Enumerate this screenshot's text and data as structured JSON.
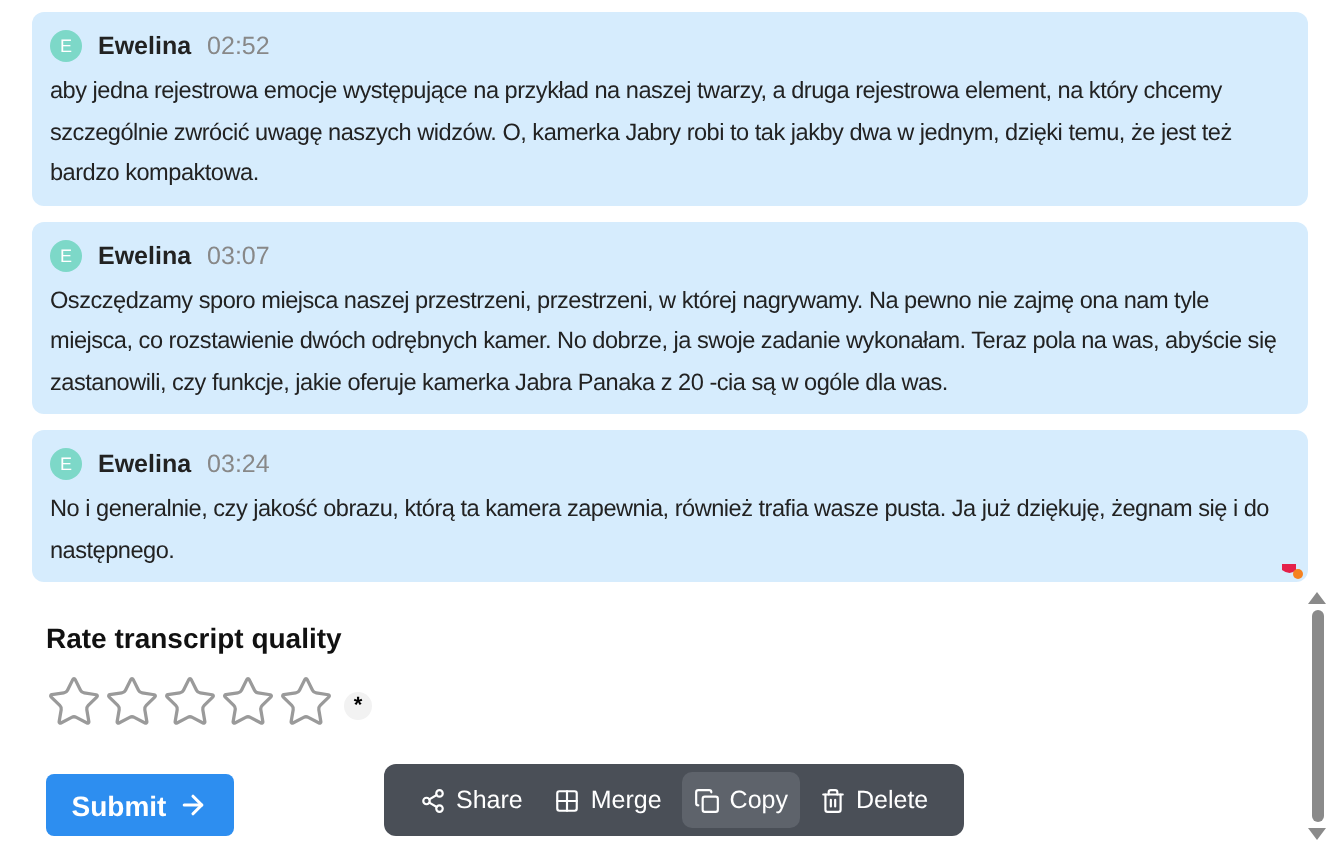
{
  "messages": [
    {
      "initial": "E",
      "speaker": "Ewelina",
      "time": "02:52",
      "text": "aby jedna rejestrowa emocje występujące na przykład na naszej twarzy, a druga rejestrowa element, na który chcemy szczególnie zwrócić uwagę naszych widzów. O, kamerka Jabry robi to tak jakby dwa w jednym, dzięki temu, że jest też bardzo kompaktowa."
    },
    {
      "initial": "E",
      "speaker": "Ewelina",
      "time": "03:07",
      "text": "Oszczędzamy sporo miejsca naszej przestrzeni, przestrzeni, w której nagrywamy. Na pewno nie zajmę ona nam tyle miejsca, co rozstawienie dwóch odrębnych kamer. No dobrze, ja swoje zadanie wykonałam. Teraz pola na was, abyście się zastanowili, czy funkcje, jakie oferuje kamerka Jabra Panaka z 20 -cia są w ogóle dla was."
    },
    {
      "initial": "E",
      "speaker": "Ewelina",
      "time": "03:24",
      "text": "No i generalnie, czy jakość obrazu, którą ta kamera zapewnia, również trafia wasze pusta. Ja już dziękuję, żegnam się i do następnego."
    }
  ],
  "rating": {
    "title": "Rate transcript quality",
    "stars": 0,
    "required_mark": "*"
  },
  "submit": {
    "label": "Submit"
  },
  "toolbar": [
    {
      "kind": "share",
      "label": "Share",
      "selected": false
    },
    {
      "kind": "merge",
      "label": "Merge",
      "selected": false
    },
    {
      "kind": "copy",
      "label": "Copy",
      "selected": true
    },
    {
      "kind": "delete",
      "label": "Delete",
      "selected": false
    }
  ]
}
